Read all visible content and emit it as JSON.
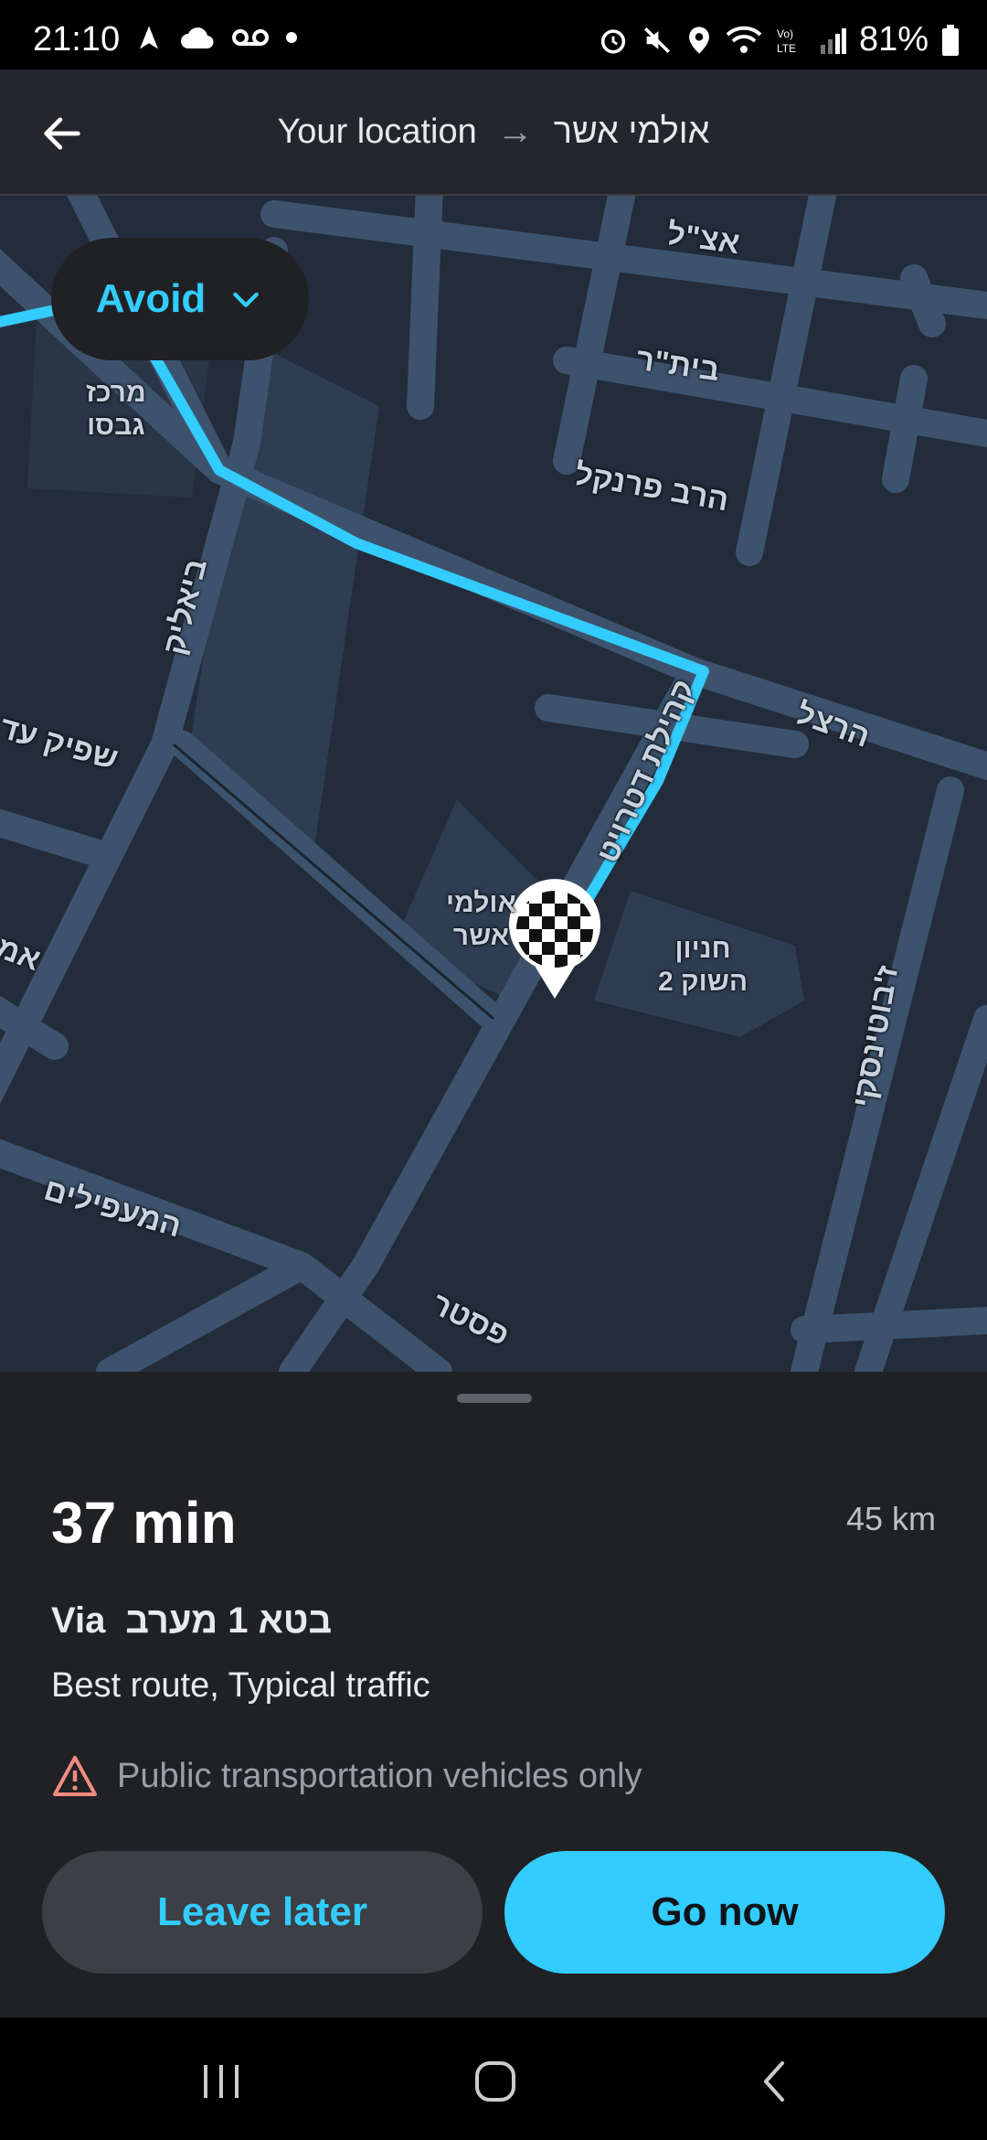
{
  "status_bar": {
    "time": "21:10",
    "battery": "81%",
    "icons": [
      "navigation-icon",
      "cloud-icon",
      "voicemail-icon",
      "dot-icon",
      "alarm-icon",
      "mute-icon",
      "location-icon",
      "wifi-icon",
      "volte-icon",
      "signal-icon",
      "battery-icon"
    ]
  },
  "header": {
    "origin": "Your location",
    "destination": "אולמי אשר",
    "back_icon": "arrow-left-icon"
  },
  "map": {
    "avoid_label": "Avoid",
    "route_color": "#33ccff",
    "street_labels": {
      "atzal": "אצ\"ל",
      "beitar": "בית\"ר",
      "harav_frankel": "הרב פרנקל",
      "merkaz_gabaso": "מרכז\nגבסו",
      "bialik": "ביאליק",
      "herzl": "הרצל",
      "kehilat_detroit": "קהילת דטרויט",
      "shapik_ad": "שפיק עד",
      "am": "אמ",
      "ulmey_asher": "אולמי\nאשר",
      "hanyon_hashuk": "חניון\nהשוק 2",
      "jabotinsky": "ז'בוטינסקי",
      "hamaapilim": "המעפילים",
      "paster": "פסטר"
    }
  },
  "route": {
    "duration": "37 min",
    "distance": "45 km",
    "via_prefix": "Via",
    "via_road": "בטא 1 מערב",
    "summary": "Best route, Typical traffic",
    "warning": "Public transportation vehicles only"
  },
  "actions": {
    "leave_later": "Leave later",
    "go_now": "Go now"
  },
  "colors": {
    "accent": "#33ccff",
    "warning": "#f28b82"
  }
}
